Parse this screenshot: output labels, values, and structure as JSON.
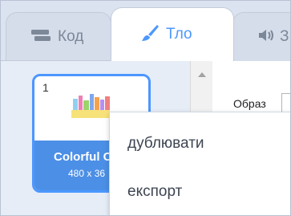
{
  "tabs": {
    "code": {
      "label": "Код",
      "icon": "code-blocks-icon"
    },
    "backdrops": {
      "label": "Тло",
      "icon": "paintbrush-icon"
    },
    "sounds": {
      "label": "З",
      "icon": "speaker-icon"
    }
  },
  "backdrop_list": {
    "items": [
      {
        "number": "1",
        "name": "Colorful C",
        "size": "480 x 36"
      }
    ]
  },
  "editor": {
    "label": "Образ"
  },
  "context_menu": {
    "items": [
      "дублювати",
      "експорт"
    ]
  },
  "colors": {
    "accent": "#4c97ff",
    "selected_caption": "#4c8fe6",
    "tab_bg": "#d5ddeb"
  }
}
